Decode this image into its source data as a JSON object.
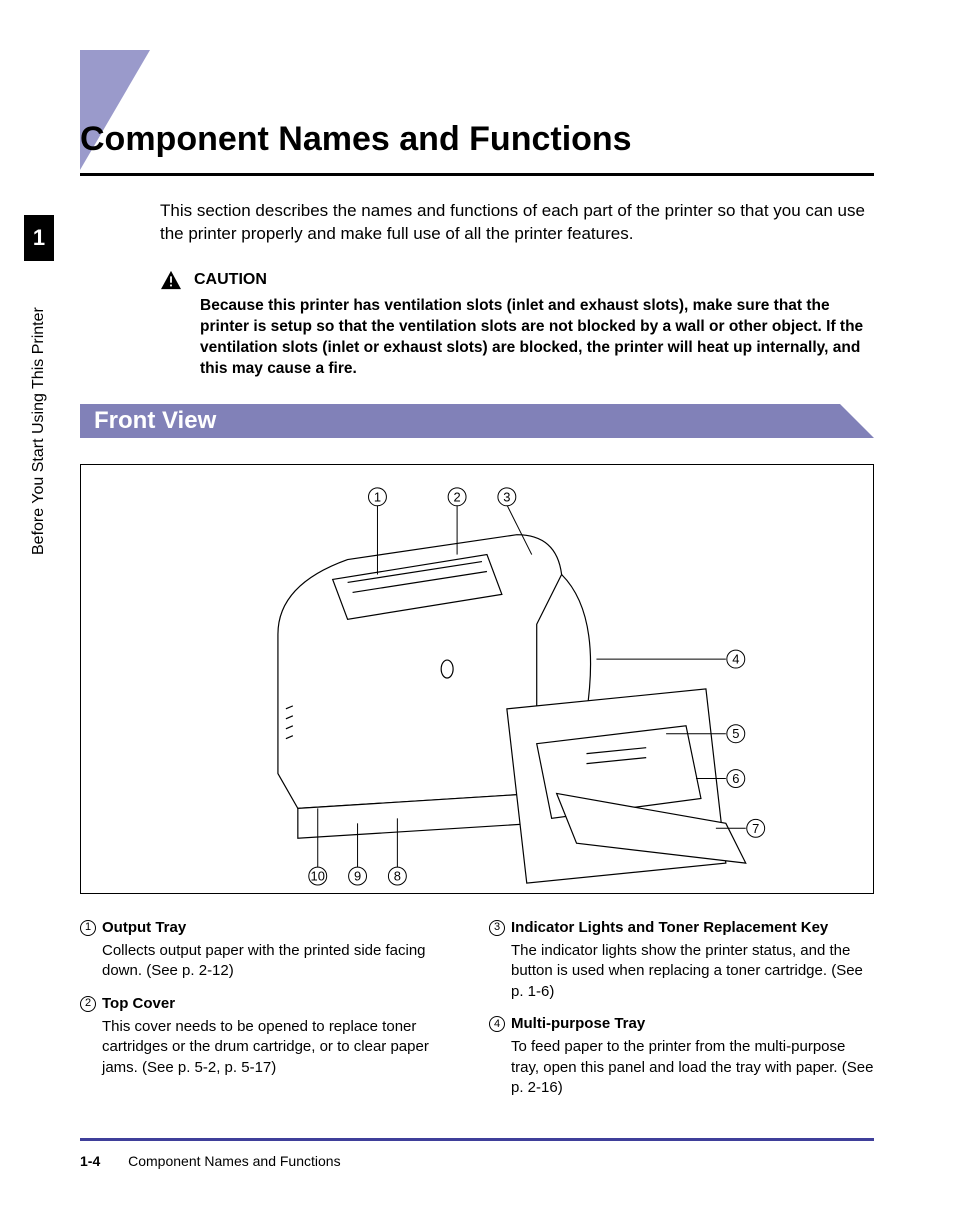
{
  "chapter_number": "1",
  "side_label": "Before You Start Using This Printer",
  "title": "Component Names and Functions",
  "intro": "This section describes the names and functions of each part of the printer so that you can use the printer properly and make full use of all the printer features.",
  "caution_label": "CAUTION",
  "caution_text": "Because this printer has ventilation slots (inlet and exhaust slots), make sure that the printer is setup so that the ventilation slots are not blocked by a wall or other object. If the ventilation slots (inlet or exhaust slots) are blocked, the printer will heat up internally, and this may cause a fire.",
  "section_heading": "Front View",
  "callouts_top": [
    "1",
    "2",
    "3"
  ],
  "callouts_right": [
    "4",
    "5",
    "6",
    "7"
  ],
  "callouts_bottom": [
    "10",
    "9",
    "8"
  ],
  "items_left": [
    {
      "num": "1",
      "title": "Output Tray",
      "body": "Collects output paper with the printed side facing down. (See p. 2-12)"
    },
    {
      "num": "2",
      "title": "Top Cover",
      "body": "This cover needs to be opened to replace toner cartridges or the drum cartridge, or to clear paper jams. (See p. 5-2, p. 5-17)"
    }
  ],
  "items_right": [
    {
      "num": "3",
      "title": "Indicator Lights and Toner Replacement Key",
      "body": "The indicator lights show the printer status, and the button is used when replacing a toner cartridge. (See p. 1-6)"
    },
    {
      "num": "4",
      "title": "Multi-purpose Tray",
      "body": "To feed paper to the printer from the multi-purpose tray, open this panel and load the tray with paper. (See p. 2-16)"
    }
  ],
  "footer_page": "1-4",
  "footer_title": "Component Names and Functions"
}
